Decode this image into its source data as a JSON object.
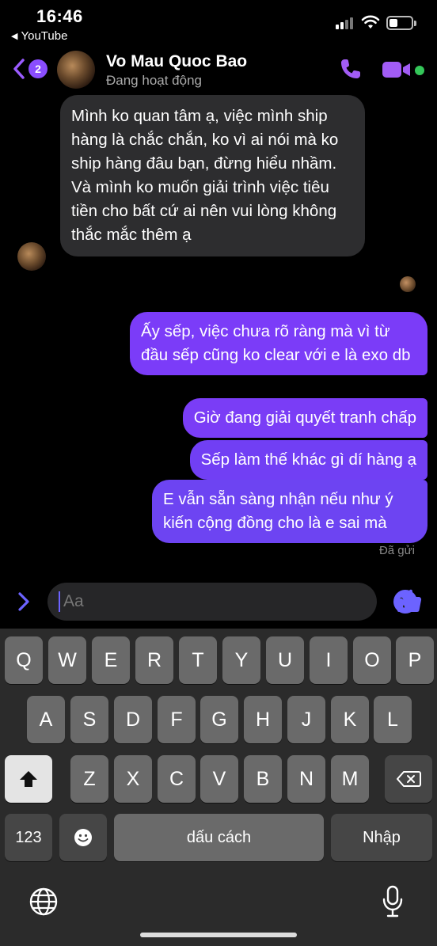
{
  "status_bar": {
    "time": "16:46",
    "back_app": "YouTube"
  },
  "header": {
    "unread_count": "2",
    "contact_name": "Vo Mau Quoc Bao",
    "contact_status": "Đang hoạt động",
    "accent_color": "#8a4dff",
    "online_color": "#34c759"
  },
  "messages": {
    "incoming": "Mình ko quan tâm ạ, việc mình ship hàng là chắc chắn, ko vì ai nói mà ko ship hàng đâu bạn, đừng hiểu nhầm. Và mình ko muốn giải trình việc tiêu tiền cho bất cứ ai nên vui lòng không thắc mắc thêm ạ",
    "outgoing": [
      "Ấy sếp, việc chưa rõ ràng mà vì từ đầu sếp cũng ko clear với e là exo db",
      "Giờ đang giải quyết tranh chấp",
      "Sếp làm thế khác gì dí hàng ạ",
      "E vẫn sẵn sàng nhận nếu như ý kiến cộng đồng cho là e sai mà"
    ],
    "sent_status": "Đã gửi"
  },
  "composer": {
    "placeholder": "Aa"
  },
  "keyboard": {
    "row1": [
      "Q",
      "W",
      "E",
      "R",
      "T",
      "Y",
      "U",
      "I",
      "O",
      "P"
    ],
    "row2": [
      "A",
      "S",
      "D",
      "F",
      "G",
      "H",
      "J",
      "K",
      "L"
    ],
    "row3": [
      "Z",
      "X",
      "C",
      "V",
      "B",
      "N",
      "M"
    ],
    "numbers_key": "123",
    "space_key": "dấu cách",
    "return_key": "Nhập"
  }
}
